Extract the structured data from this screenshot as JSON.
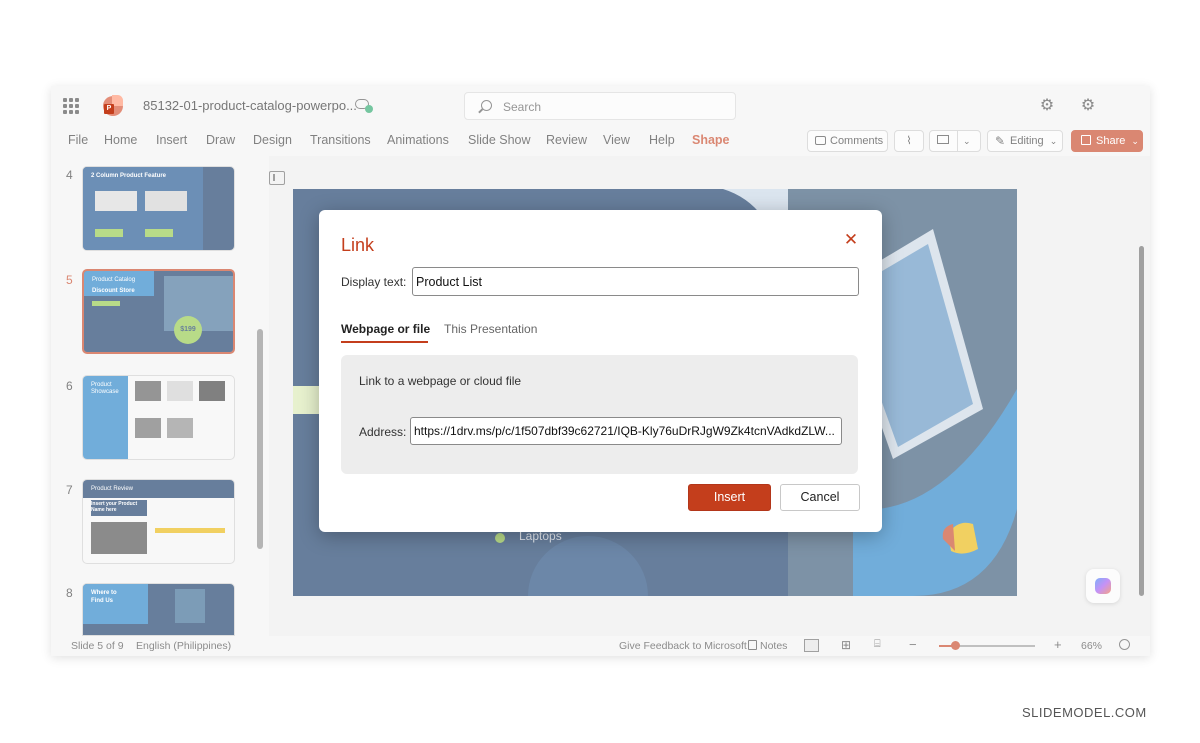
{
  "window": {
    "doc_title": "85132-01-product-catalog-powerpo...",
    "search_label": "Search"
  },
  "menu": {
    "items": [
      "File",
      "Home",
      "Insert",
      "Draw",
      "Design",
      "Transitions",
      "Animations",
      "Slide Show",
      "Review",
      "View",
      "Help",
      "Shape"
    ],
    "active": "Shape",
    "comments_label": "Comments",
    "editing_label": "Editing",
    "share_label": "Share"
  },
  "thumbnails": [
    {
      "number": "4",
      "title": "2 Column Product Feature",
      "active": false
    },
    {
      "number": "5",
      "title": "Product Catalog",
      "subtitle": "Discount Store",
      "price": "$199",
      "active": true
    },
    {
      "number": "6",
      "title": "Product",
      "subtitle": "Showcase",
      "active": false
    },
    {
      "number": "7",
      "title": "Product Review",
      "subtitle": "Insert your Product Name here",
      "active": false
    },
    {
      "number": "8",
      "title": "Where to",
      "subtitle": "Find Us",
      "active": false
    }
  ],
  "slide": {
    "bullet_text": "Laptops"
  },
  "status": {
    "slide_info": "Slide 5 of 9",
    "language": "English (Philippines)",
    "feedback": "Give Feedback to Microsoft",
    "notes": "Notes",
    "zoom": "66%"
  },
  "dialog": {
    "title": "Link",
    "display_text_label": "Display text:",
    "display_text_value": "Product List",
    "tabs": [
      "Webpage or file",
      "This Presentation"
    ],
    "section_heading": "Link to a webpage or cloud file",
    "address_label": "Address:",
    "address_value": "https://1drv.ms/p/c/1f507dbf39c62721/IQB-Kly76uDrRJgW9Zk4tcnVAdkdZLW...",
    "insert_label": "Insert",
    "cancel_label": "Cancel"
  },
  "colors": {
    "accent": "#c43e1c",
    "slide_bg": "#0a2f5f",
    "slide_blue": "#1a7bc4",
    "slide_green": "#8dc63f"
  },
  "watermark": "SLIDEMODEL.COM"
}
